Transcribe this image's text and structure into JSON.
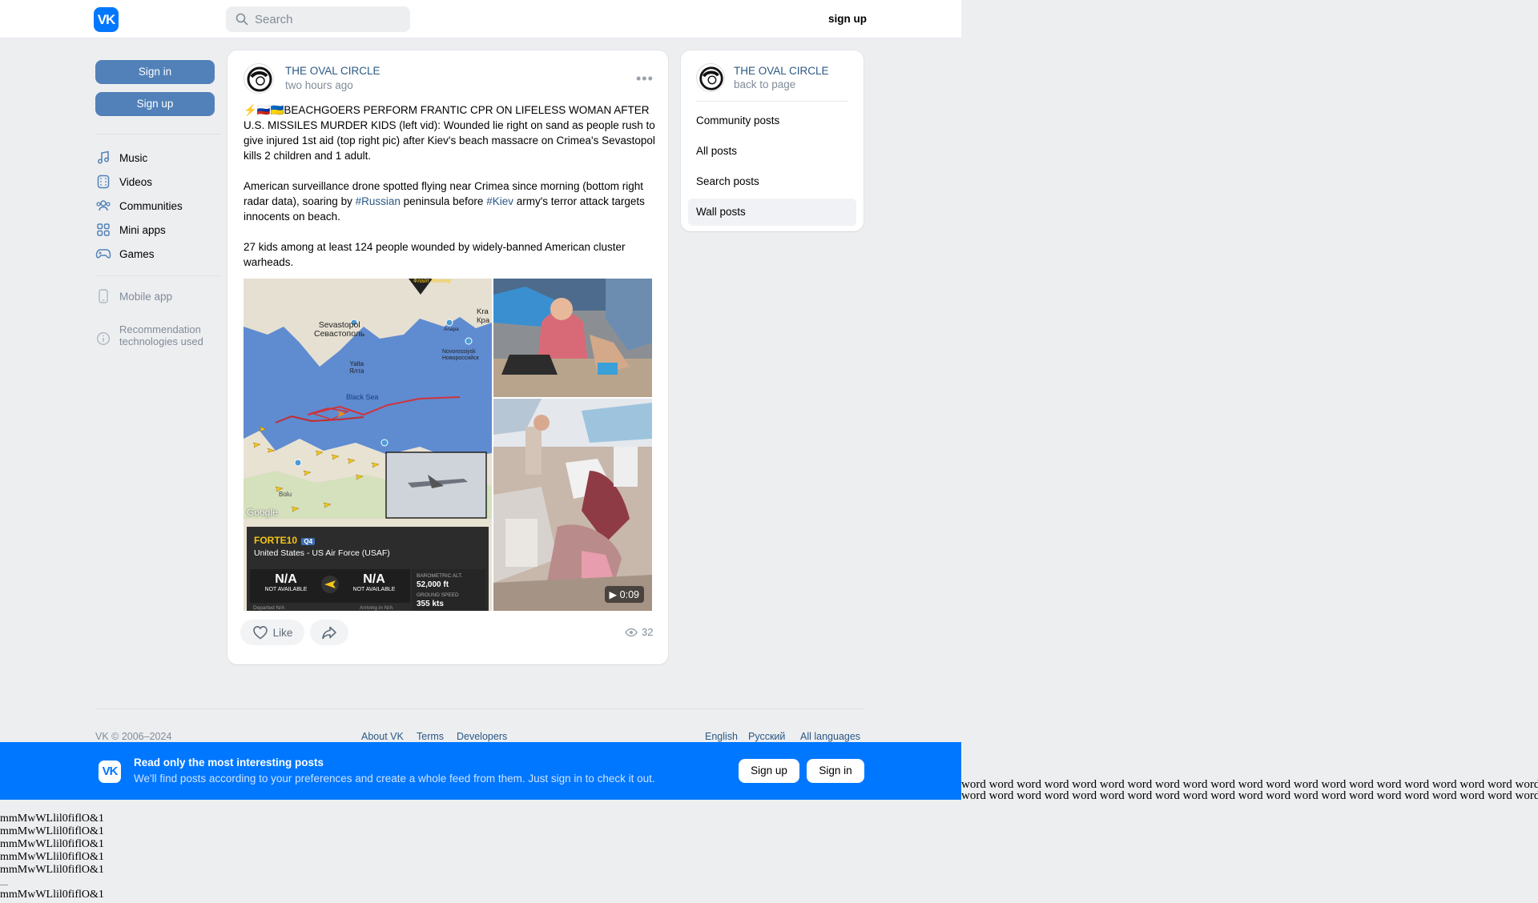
{
  "header": {
    "logo_text": "VK",
    "search_placeholder": "Search",
    "signup_label": "sign up"
  },
  "left_nav": {
    "sign_in": "Sign in",
    "sign_up": "Sign up",
    "items": [
      {
        "label": "Music",
        "icon": "music-icon"
      },
      {
        "label": "Videos",
        "icon": "video-icon"
      },
      {
        "label": "Communities",
        "icon": "communities-icon"
      },
      {
        "label": "Mini apps",
        "icon": "mini-apps-icon"
      },
      {
        "label": "Games",
        "icon": "games-icon"
      }
    ],
    "mobile_app": "Mobile app",
    "recommendation_line1": "Recommendation",
    "recommendation_line2": "technologies used"
  },
  "post": {
    "author": "THE OVAL CIRCLE",
    "time": "two hours ago",
    "para1": "⚡🇷🇺🇺🇦BEACHGOERS PERFORM FRANTIC CPR ON LIFELESS WOMAN AFTER U.S. MISSILES MURDER KIDS (left vid): Wounded lie right on sand as people rush to give injured 1st aid (top right pic) after Kiev's beach massacre on Crimea's Sevastopol kills 2 children and 1 adult.",
    "para2_a": "American surveillance drone spotted flying near Crimea since morning (bottom right radar data), soaring by ",
    "tag_russian": "#Russian",
    "para2_b": " peninsula before ",
    "tag_kiev": "#Kiev",
    "para2_c": " army's terror attack targets innocents on beach.",
    "para3": "27 kids among at least 124 people wounded by widely-banned American cluster warheads.",
    "map": {
      "sevastopol": "Sevastopol",
      "sevastopol_ru": "Севастополь",
      "yalta": "Yalta",
      "yalta_ru": "Ялта",
      "anapa": "Anapa",
      "novorossiysk": "Novorossiysk",
      "novorossiysk_ru": "Новороссийск",
      "kra": "Kra",
      "kra2": "Кра",
      "black_sea": "Black Sea",
      "google": "Google",
      "bolu": "Bolu",
      "top_label": "Флайт Мейкер",
      "flight_id": "FORTE10",
      "flight_badge": "Q4",
      "operator": "United States - US Air Force (USAF)",
      "na1": "N/A",
      "na1_sub": "NOT AVAILABLE",
      "na2": "N/A",
      "na2_sub": "NOT AVAILABLE",
      "baro_label": "BAROMETRIC ALT.",
      "baro_value": "52,000 ft",
      "gs_label": "GROUND SPEED",
      "gs_value": "355 kts",
      "departed": "Departed N/A",
      "arriving": "Arriving in N/A"
    },
    "video_duration": "0:09",
    "like_label": "Like",
    "views": "32"
  },
  "side_panel": {
    "author": "THE OVAL CIRCLE",
    "back": "back to page",
    "items": [
      "Community posts",
      "All posts",
      "Search posts",
      "Wall posts"
    ]
  },
  "footer": {
    "copyright": "VK © 2006–2024",
    "about": "About VK",
    "terms": "Terms",
    "developers": "Developers",
    "english": "English",
    "russian": "Русский",
    "all_languages": "All languages"
  },
  "banner": {
    "title": "Read only the most interesting posts",
    "subtitle": "We'll find posts according to your preferences and create a whole feed from them. Just sign in to check it out.",
    "sign_up": "Sign up",
    "sign_in": "Sign in"
  },
  "debug": {
    "word_row": "word word word word word word word word word word word word word word word word word word word word word word word word word word word word word word word word word word word word word word word word",
    "glyph_line": "mmMwWLlil0fiflO&1"
  },
  "colors": {
    "brand": "#0077ff",
    "button_blue": "#5181b8",
    "link": "#2a5885",
    "muted": "#818c99",
    "page_bg": "#edeef0"
  }
}
